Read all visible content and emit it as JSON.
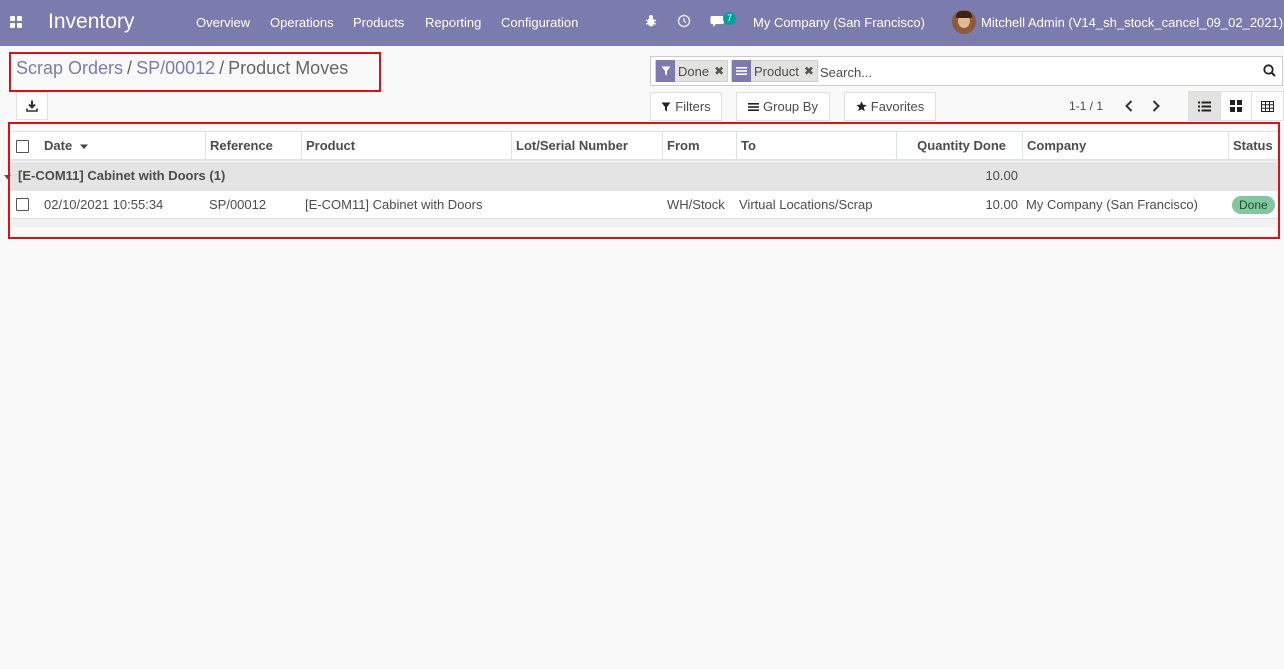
{
  "navbar": {
    "brand": "Inventory",
    "menu": [
      "Overview",
      "Operations",
      "Products",
      "Reporting",
      "Configuration"
    ],
    "message_count": "7",
    "company": "My Company (San Francisco)",
    "user": "Mitchell Admin (V14_sh_stock_cancel_09_02_2021)",
    "icons": [
      "apps-grid-icon",
      "bug-icon",
      "clock-icon",
      "chat-icon"
    ],
    "accent": "#7c7bad"
  },
  "breadcrumb": {
    "items": [
      "Scrap Orders",
      "SP/00012"
    ],
    "current": "Product Moves"
  },
  "search": {
    "facets": [
      {
        "icon": "filter-icon",
        "label": "Done"
      },
      {
        "icon": "group-by-icon",
        "label": "Product"
      }
    ],
    "placeholder": "Search..."
  },
  "controls": {
    "filters": "Filters",
    "group_by": "Group By",
    "favorites": "Favorites",
    "pager": "1-1 / 1"
  },
  "table": {
    "columns": [
      "Date",
      "Reference",
      "Product",
      "Lot/Serial Number",
      "From",
      "To",
      "Quantity Done",
      "Company",
      "Status"
    ],
    "group": {
      "label": "[E-COM11] Cabinet with Doors (1)",
      "quantity_total": "10.00"
    },
    "rows": [
      {
        "date": "02/10/2021 10:55:34",
        "reference": "SP/00012",
        "product": "[E-COM11] Cabinet with Doors",
        "lot": "",
        "from": "WH/Stock",
        "to": "Virtual Locations/Scrap",
        "quantity": "10.00",
        "company": "My Company (San Francisco)",
        "status": "Done"
      }
    ]
  },
  "colors": {
    "highlight": "#d9111b",
    "status_done": "#83c6a0"
  }
}
